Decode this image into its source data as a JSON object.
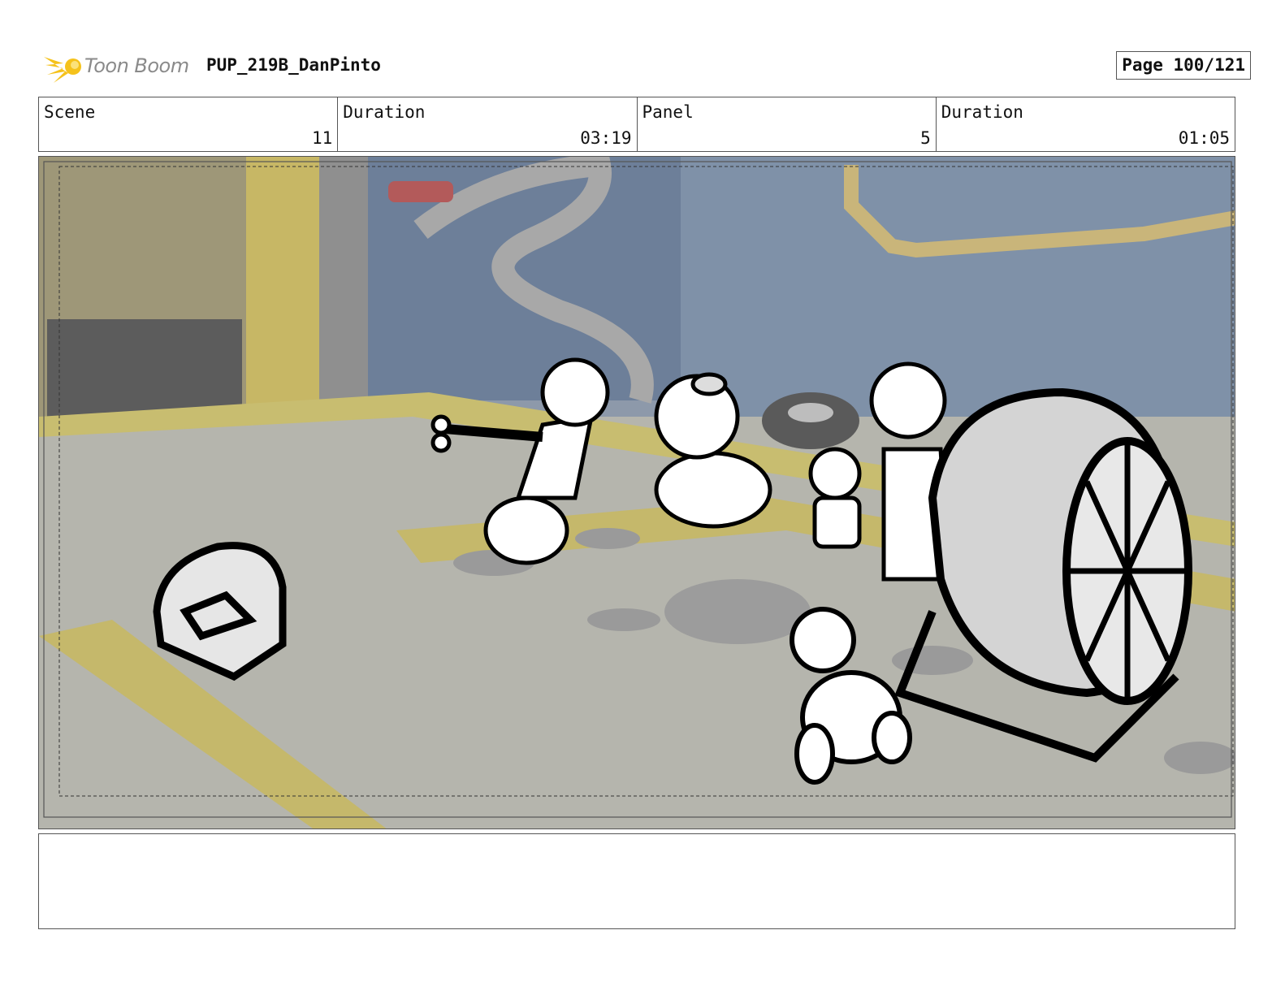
{
  "header": {
    "brand": "Toon Boom",
    "project": "PUP_219B_DanPinto",
    "page": "Page 100/121"
  },
  "info": {
    "scene_label": "Scene",
    "scene_value": "11",
    "duration_label": "Duration",
    "duration_value": "03:19",
    "panel_label": "Panel",
    "panel_value": "5",
    "panel_duration_label": "Duration",
    "panel_duration_value": "01:05"
  },
  "notes": {
    "text": ""
  },
  "icons": {
    "logo": "toon-boom-logo-icon"
  },
  "colors": {
    "logo_accent": "#f5c21b",
    "wall": "#7e8fa6",
    "floor": "#b3b3aa",
    "floor_stripe": "#c9b95a"
  }
}
